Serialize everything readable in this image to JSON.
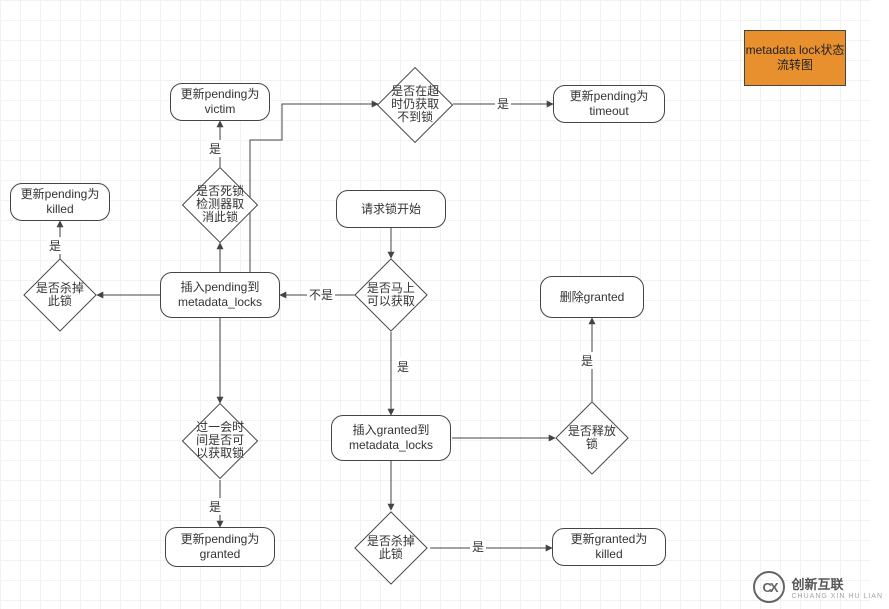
{
  "title": {
    "text": "metadata lock状态流转图"
  },
  "nodes": {
    "start": {
      "text": "请求锁开始"
    },
    "d_immediate": {
      "text": "是否马上可以获取"
    },
    "p_insert_pending": {
      "text": "插入pending到metadata_locks"
    },
    "d_kill_left": {
      "text": "是否杀掉此锁"
    },
    "p_killed": {
      "text": "更新pending为killed"
    },
    "d_deadlock": {
      "text": "是否死锁检测器取消此锁"
    },
    "p_victim": {
      "text": "更新pending为victim"
    },
    "d_timeout": {
      "text": "是否在超时仍获取不到锁"
    },
    "p_timeout": {
      "text": "更新pending为timeout"
    },
    "d_wait_acquire": {
      "text": "过一会时间是否可以获取锁"
    },
    "p_granted_pending": {
      "text": "更新pending为granted"
    },
    "p_insert_granted": {
      "text": "插入granted到metadata_locks"
    },
    "d_release": {
      "text": "是否释放锁"
    },
    "p_delete_granted": {
      "text": "删除granted"
    },
    "d_kill_right": {
      "text": "是否杀掉此锁"
    },
    "p_granted_killed": {
      "text": "更新granted为killed"
    }
  },
  "edge_labels": {
    "not": "不是",
    "yes_immediate": "是",
    "yes_kill_left": "是",
    "yes_deadlock": "是",
    "yes_timeout": "是",
    "yes_wait": "是",
    "yes_release": "是",
    "yes_kill_right": "是"
  },
  "watermark": {
    "zh": "创新互联",
    "en": "CHUANG XIN HU LIAN"
  }
}
